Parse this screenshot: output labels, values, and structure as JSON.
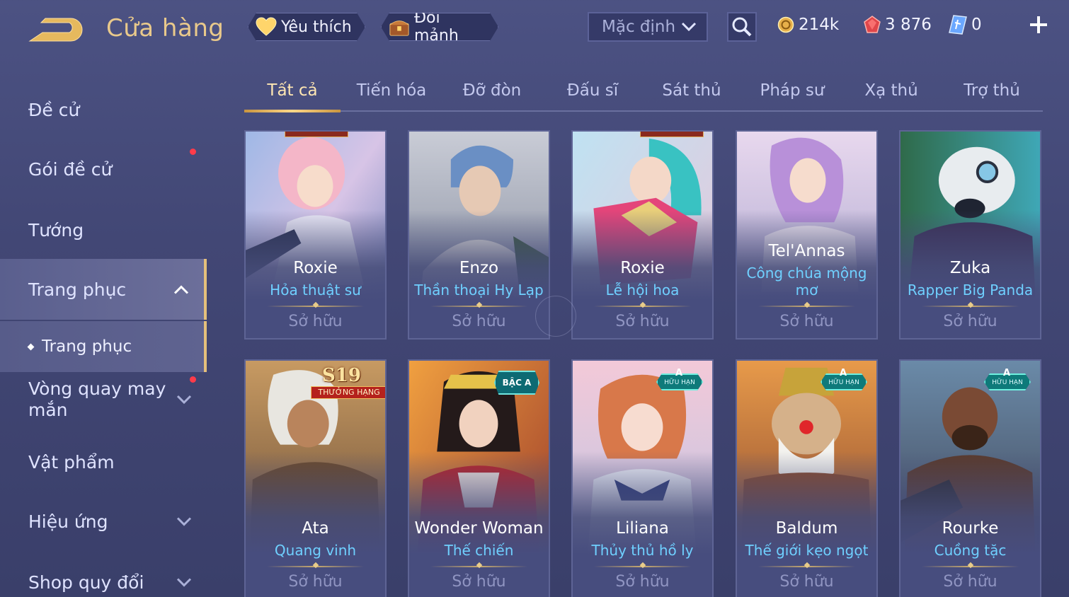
{
  "header": {
    "title": "Cửa hàng",
    "favorites_label": "Yêu thích",
    "exchange_label": "Đổi mảnh",
    "sort_value": "Mặc định",
    "currencies": [
      {
        "icon": "gold-coin-icon",
        "value": "214k"
      },
      {
        "icon": "red-gem-icon",
        "value": "3 876"
      },
      {
        "icon": "voucher-icon",
        "value": "0"
      }
    ]
  },
  "sidebar": {
    "items": [
      {
        "label": "Đề cử"
      },
      {
        "label": "Gói đề cử"
      },
      {
        "label": "Tướng"
      },
      {
        "label": "Trang phục"
      },
      {
        "label": "Vòng quay may mắn"
      },
      {
        "label": "Vật phẩm"
      },
      {
        "label": "Hiệu ứng"
      },
      {
        "label": "Shop quy đổi"
      }
    ],
    "sub_item": "Trang phục"
  },
  "tabs": [
    "Tất cả",
    "Tiến hóa",
    "Đỡ đòn",
    "Đấu sĩ",
    "Sát thủ",
    "Pháp sư",
    "Xạ thủ",
    "Trợ thủ"
  ],
  "cards": [
    {
      "hero": "Roxie",
      "skin": "Hỏa thuật sư",
      "status": "Sở hữu"
    },
    {
      "hero": "Enzo",
      "skin": "Thần thoại Hy Lạp",
      "status": "Sở hữu"
    },
    {
      "hero": "Roxie",
      "skin": "Lễ hội hoa",
      "status": "Sở hữu"
    },
    {
      "hero": "Tel'Annas",
      "skin": "Công chúa mộng mơ",
      "status": "Sở hữu"
    },
    {
      "hero": "Zuka",
      "skin": "Rapper Big Panda",
      "status": "Sở hữu"
    },
    {
      "hero": "Ata",
      "skin": "Quang vinh",
      "status": "Sở hữu",
      "badge_season": "S19",
      "badge_text": "THƯỞNG HẠNG"
    },
    {
      "hero": "Wonder Woman",
      "skin": "Thế chiến",
      "status": "Sở hữu",
      "badge_tier": "BẬC A"
    },
    {
      "hero": "Liliana",
      "skin": "Thủy thủ hồ ly",
      "status": "Sở hữu",
      "badge_grade": "A",
      "badge_limited": "HỮU HẠN"
    },
    {
      "hero": "Baldum",
      "skin": "Thế giới kẹo ngọt",
      "status": "Sở hữu",
      "badge_grade": "A",
      "badge_limited": "HỮU HẠN"
    },
    {
      "hero": "Rourke",
      "skin": "Cuồng tặc",
      "status": "Sở hữu",
      "badge_grade": "A",
      "badge_limited": "HỮU HẠN"
    }
  ],
  "row1_badge_text": "THƯỞNG HẠNG",
  "colors": {
    "accent_gold": "#e9c98b",
    "skin_name": "#6fd0ff",
    "notify_dot": "#ff3b4a",
    "badge_teal": "#0e7a7a"
  }
}
